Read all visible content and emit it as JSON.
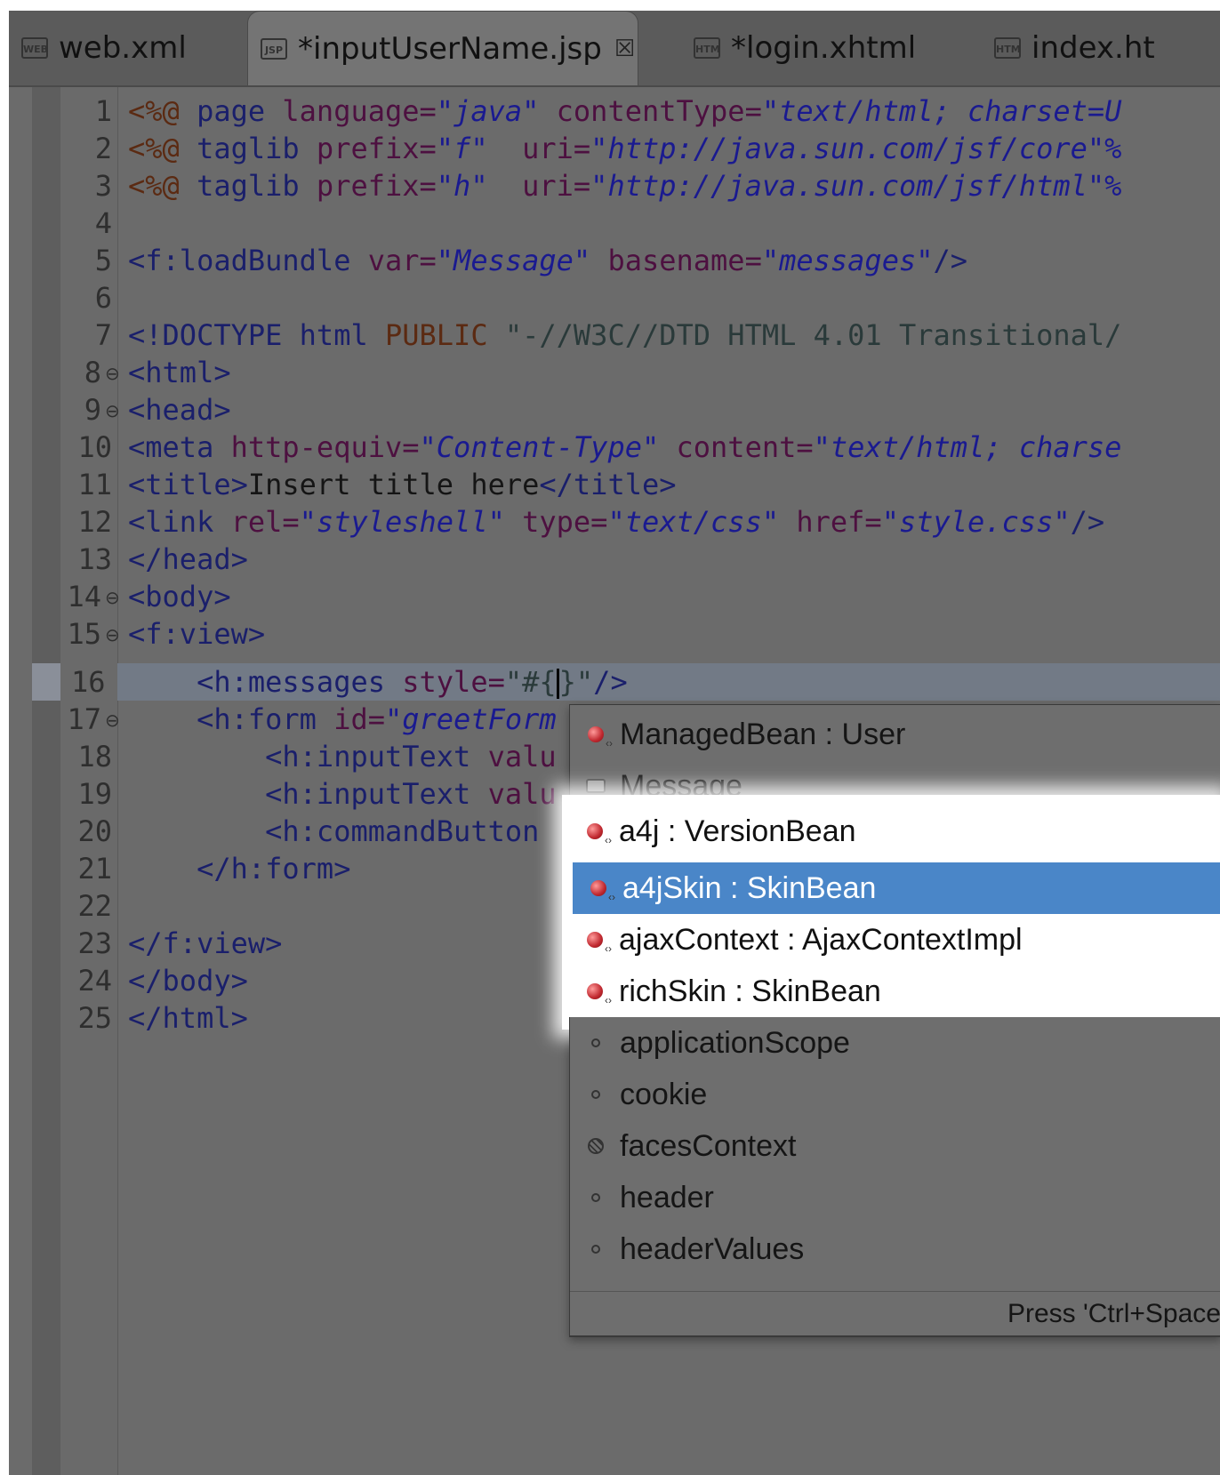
{
  "tabs": [
    {
      "label": "web.xml",
      "icon": "web-xml-icon"
    },
    {
      "label": "*inputUserName.jsp",
      "icon": "jsp-file-icon",
      "close": "☒"
    },
    {
      "label": "*login.xhtml",
      "icon": "html-file-icon"
    },
    {
      "label": "index.ht",
      "icon": "html-file-icon"
    }
  ],
  "editor": {
    "line_numbers": [
      "1",
      "2",
      "3",
      "4",
      "5",
      "6",
      "7",
      "8",
      "9",
      "10",
      "11",
      "12",
      "13",
      "14",
      "15",
      "16",
      "17",
      "18",
      "19",
      "20",
      "21",
      "22",
      "23",
      "24",
      "25"
    ],
    "lines": {
      "l1": {
        "d": "<%@",
        "t1": " page ",
        "a1": "language=",
        "v1": "\"java\"",
        "a2": " contentType=",
        "v2": "\"text/html; charset=U"
      },
      "l2": {
        "d": "<%@",
        "t1": " taglib ",
        "a1": "prefix=",
        "v1": "\"f\"",
        "a2": "  uri=",
        "v2": "\"http://java.sun.com/jsf/core\"%"
      },
      "l3": {
        "d": "<%@",
        "t1": " taglib ",
        "a1": "prefix=",
        "v1": "\"h\"",
        "a2": "  uri=",
        "v2": "\"http://java.sun.com/jsf/html\"%"
      },
      "l5": {
        "t1": "<f:loadBundle ",
        "a1": "var=",
        "v1": "\"Message\"",
        "a2": " basename=",
        "v2": "\"messages\"",
        "t2": "/>"
      },
      "l7": {
        "t1": "<!DOCTYPE html ",
        "p1": "PUBLIC ",
        "s1": "\"-//W3C//DTD HTML 4.01 Transitional/"
      },
      "l8": {
        "t1": "<html>"
      },
      "l9": {
        "t1": "<head>"
      },
      "l10": {
        "t1": "<meta ",
        "a1": "http-equiv=",
        "v1": "\"Content-Type\"",
        "a2": " content=",
        "v2": "\"text/html; charse"
      },
      "l11": {
        "t1": "<title>",
        "x1": "Insert title here",
        "t2": "</title>"
      },
      "l12": {
        "t1": "<link ",
        "a1": "rel=",
        "v1": "\"styleshell\"",
        "a2": " type=",
        "v2": "\"text/css\"",
        "a3": " href=",
        "v3": "\"style.css\"",
        "t2": "/>"
      },
      "l13": {
        "t1": "</head>"
      },
      "l14": {
        "t1": "<body>"
      },
      "l15": {
        "t1": "<f:view>"
      },
      "l16": {
        "t1": "    <h:messages ",
        "a1": "style=",
        "v1": "\"#{",
        "v2": "}\"",
        "t2": "/>"
      },
      "l17": {
        "t1": "    <h:form ",
        "a1": "id=",
        "v1": "\"greetForm"
      },
      "l18": {
        "t1": "        <h:inputText ",
        "a1": "valu"
      },
      "l19": {
        "t1": "        <h:inputText ",
        "a1": "valu"
      },
      "l20": {
        "t1": "        <h:commandButton"
      },
      "l21": {
        "t1": "    </h:form>"
      },
      "l23": {
        "t1": "</f:view>"
      },
      "l24": {
        "t1": "</body>"
      },
      "l25": {
        "t1": "</html>"
      }
    }
  },
  "autocomplete": {
    "items": [
      {
        "label": "ManagedBean : User",
        "icon": "managed-bean-icon"
      },
      {
        "label": "Message",
        "icon": "resource-bundle-icon"
      },
      {
        "label": "a4j : VersionBean",
        "icon": "managed-bean-icon"
      },
      {
        "label": "a4jSkin : SkinBean",
        "icon": "managed-bean-icon",
        "selected": true
      },
      {
        "label": "ajaxContext : AjaxContextImpl",
        "icon": "managed-bean-icon"
      },
      {
        "label": "richSkin : SkinBean",
        "icon": "managed-bean-icon"
      },
      {
        "label": "applicationScope",
        "icon": "implicit-object-icon"
      },
      {
        "label": "cookie",
        "icon": "implicit-object-icon"
      },
      {
        "label": "facesContext",
        "icon": "faces-context-icon"
      },
      {
        "label": "header",
        "icon": "implicit-object-icon"
      },
      {
        "label": "headerValues",
        "icon": "implicit-object-icon"
      }
    ],
    "footer": "Press 'Ctrl+Space"
  },
  "colors": {
    "selection": "#4a86c8",
    "highlight": "#ffffff"
  }
}
